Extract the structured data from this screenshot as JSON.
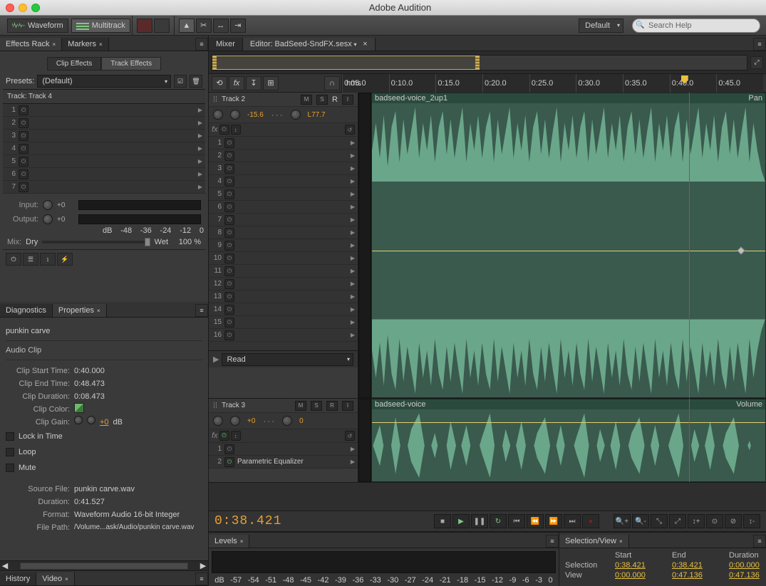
{
  "app": {
    "title": "Adobe Audition"
  },
  "modes": {
    "waveform": "Waveform",
    "multitrack": "Multitrack"
  },
  "workspace": {
    "current": "Default"
  },
  "search": {
    "placeholder": "Search Help"
  },
  "effectsRack": {
    "tab": "Effects Rack",
    "markersTab": "Markers",
    "clipEffects": "Clip Effects",
    "trackEffects": "Track Effects",
    "presetsLabel": "Presets:",
    "presetValue": "(Default)",
    "trackLabel": "Track: Track 4",
    "slots": [
      1,
      2,
      3,
      4,
      5,
      6,
      7
    ],
    "inputLabel": "Input:",
    "outputLabel": "Output:",
    "ioVal": "+0",
    "meterScale": [
      "dB",
      "-48",
      "-36",
      "-24",
      "-12",
      "0"
    ],
    "mixLabel": "Mix:",
    "dry": "Dry",
    "wet": "Wet",
    "pct": "100 %"
  },
  "diagnostics": {
    "tab": "Diagnostics"
  },
  "properties": {
    "tab": "Properties",
    "clipName": "punkin carve",
    "section": "Audio Clip",
    "clipStartLabel": "Clip Start Time:",
    "clipStart": "0:40.000",
    "clipEndLabel": "Clip End Time:",
    "clipEnd": "0:48.473",
    "clipDurLabel": "Clip Duration:",
    "clipDur": "0:08.473",
    "clipColorLabel": "Clip Color:",
    "clipGainLabel": "Clip Gain:",
    "clipGain": "+0",
    "db": "dB",
    "lockInTime": "Lock in Time",
    "loop": "Loop",
    "mute": "Mute",
    "srcFileLabel": "Source File:",
    "srcFile": "punkin carve.wav",
    "durLabel": "Duration:",
    "dur": "0:41.527",
    "formatLabel": "Format:",
    "format": "Waveform Audio 16-bit Integer",
    "pathLabel": "File Path:",
    "path": "/Volume...ask/Audio/punkin carve.wav"
  },
  "historyTab": "History",
  "videoTab": "Video",
  "editor": {
    "mixerTab": "Mixer",
    "editorTab": "Editor:",
    "fileName": "BadSeed-SndFX.sesx",
    "rulerUnit": "hms",
    "rulerMarks": [
      "0:05.0",
      "0:10.0",
      "0:15.0",
      "0:20.0",
      "0:25.0",
      "0:30.0",
      "0:35.0",
      "0:40.0",
      "0:45.0"
    ]
  },
  "track2": {
    "name": "Track 2",
    "vol": "-15.6",
    "pan": "L77.7",
    "slots": [
      1,
      2,
      3,
      4,
      5,
      6,
      7,
      8,
      9,
      10,
      11,
      12,
      13,
      14,
      15,
      16
    ],
    "automation": "Read",
    "clipName": "badseed-voice_2up1",
    "panLabel": "Pan"
  },
  "track3": {
    "name": "Track 3",
    "vol": "+0",
    "pan": "0",
    "slots": [
      1,
      2
    ],
    "slot2name": "Parametric Equalizer",
    "clipName": "badseed-voice",
    "volLabel": "Volume"
  },
  "transport": {
    "timecode": "0:38.421"
  },
  "levels": {
    "tab": "Levels",
    "scale": [
      "dB",
      "-57",
      "-54",
      "-51",
      "-48",
      "-45",
      "-42",
      "-39",
      "-36",
      "-33",
      "-30",
      "-27",
      "-24",
      "-21",
      "-18",
      "-15",
      "-12",
      "-9",
      "-6",
      "-3",
      "0"
    ]
  },
  "selView": {
    "tab": "Selection/View",
    "hdrs": [
      "Start",
      "End",
      "Duration"
    ],
    "selLabel": "Selection",
    "sel": [
      "0:38.421",
      "0:38.421",
      "0:00.000"
    ],
    "viewLabel": "View",
    "view": [
      "0:00.000",
      "0:47.136",
      "0:47.136"
    ]
  }
}
